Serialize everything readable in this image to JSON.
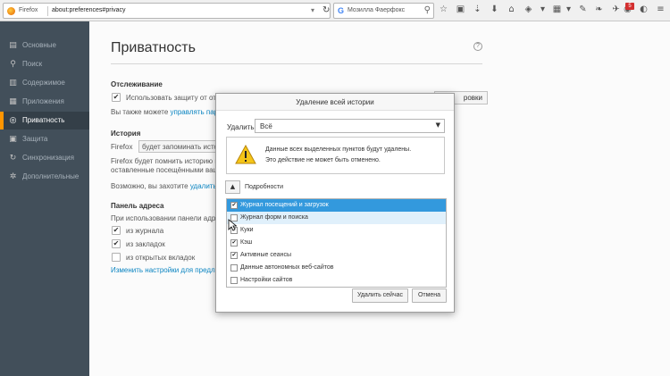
{
  "browser": {
    "identity_label": "Firefox",
    "url": "about:preferences#privacy",
    "search_engine_glyph": "G",
    "search_placeholder": "Мозилла Фаерфокс",
    "notification_badge": "5",
    "toolbar_icons": [
      "star-icon",
      "reading-list-icon",
      "downloads-icon",
      "home-icon",
      "pocket-icon",
      "grid-icon",
      "bookmark-pin-icon",
      "addon-icon",
      "menu-icon"
    ]
  },
  "sidebar": {
    "items": [
      {
        "label": "Основные",
        "icon": "general-icon"
      },
      {
        "label": "Поиск",
        "icon": "search-icon"
      },
      {
        "label": "Содержимое",
        "icon": "content-icon"
      },
      {
        "label": "Приложения",
        "icon": "applications-icon"
      },
      {
        "label": "Приватность",
        "icon": "privacy-mask-icon",
        "active": true
      },
      {
        "label": "Защита",
        "icon": "lock-icon"
      },
      {
        "label": "Синхронизация",
        "icon": "sync-icon"
      },
      {
        "label": "Дополнительные",
        "icon": "advanced-icon"
      }
    ]
  },
  "main": {
    "title": "Приватность",
    "tracking": {
      "heading": "Отслеживание",
      "use_protection": "Использовать защиту от от",
      "also_can": "Вы также можете",
      "also_link": "управлять пар",
      "button_fragment": "ровки"
    },
    "history": {
      "heading": "История",
      "firefox_will": "Firefox",
      "will_remember": "будет запоминать исто",
      "desc_line1": "Firefox будет помнить историю п",
      "desc_line2": "оставленные посещёнными ваш",
      "maybe_you": "Возможно, вы захотите",
      "delete_link": "удалить"
    },
    "address_bar": {
      "heading": "Панель адреса",
      "when_using": "При использовании панели адр",
      "from_history": "из журнала",
      "from_bookmarks": "из закладок",
      "from_open_tabs": "из открытых вкладок",
      "change_settings_link": "Изменить настройки для предл"
    }
  },
  "dialog": {
    "title": "Удаление всей истории",
    "delete_label": "Удалить:",
    "range_value": "Всё",
    "warning_line1": "Данные всех выделенных пунктов будут удалены.",
    "warning_line2": "Это действие не может быть отменено.",
    "details_label": "Подробности",
    "items": [
      {
        "label": "Журнал посещений и загрузок",
        "checked": true,
        "state": "selected"
      },
      {
        "label": "Журнал форм и поиска",
        "checked": false,
        "state": "hover"
      },
      {
        "label": "Куки",
        "checked": true,
        "state": "normal"
      },
      {
        "label": "Кэш",
        "checked": true,
        "state": "normal"
      },
      {
        "label": "Активные сеансы",
        "checked": true,
        "state": "normal"
      },
      {
        "label": "Данные автономных веб-сайтов",
        "checked": false,
        "state": "normal"
      },
      {
        "label": "Настройки сайтов",
        "checked": false,
        "state": "normal"
      }
    ],
    "clear_now_button": "Удалить сейчас",
    "cancel_button": "Отмена"
  },
  "colors": {
    "sidebar_bg": "#424f5a",
    "sidebar_active_bar": "#ff9500",
    "link": "#0a84c1",
    "list_selection": "#3399dd"
  }
}
